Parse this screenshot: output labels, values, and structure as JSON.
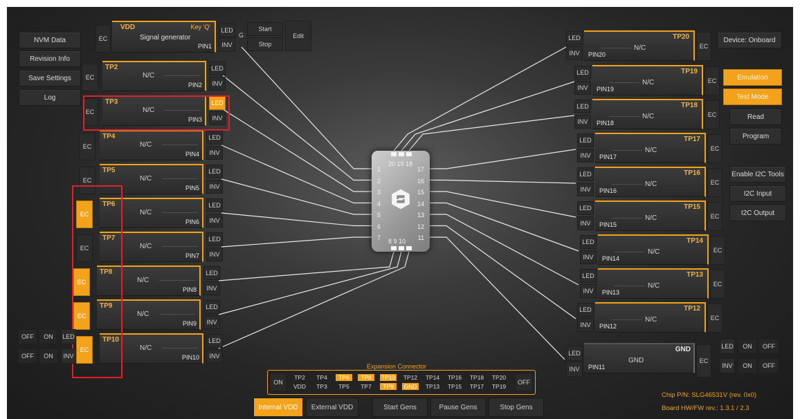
{
  "menu": {
    "left": [
      "NVM Data",
      "Revision Info",
      "Save Settings",
      "Log"
    ],
    "device": "Device: Onboard",
    "mode": [
      "Emulation",
      "Test Mode",
      "Read",
      "Program"
    ],
    "i2c": [
      "Enable I2C Tools",
      "I2C Input",
      "I2C Output"
    ]
  },
  "vdd": {
    "ec": "EC",
    "name": "VDD",
    "key": "Key 'Q'",
    "title": "Signal generator",
    "pin": "PIN1",
    "led": "LED",
    "inv": "INV",
    "g": "G",
    "start": "Start",
    "stop": "Stop",
    "edit": "Edit"
  },
  "common": {
    "nc": "N/C",
    "ec": "EC",
    "led": "LED",
    "inv": "INV"
  },
  "left_tps": [
    {
      "name": "TP2",
      "pin": "PIN2"
    },
    {
      "name": "TP3",
      "pin": "PIN3"
    },
    {
      "name": "TP4",
      "pin": "PIN4"
    },
    {
      "name": "TP5",
      "pin": "PIN5"
    },
    {
      "name": "TP6",
      "pin": "PIN6"
    },
    {
      "name": "TP7",
      "pin": "PIN7"
    },
    {
      "name": "TP8",
      "pin": "PIN8"
    },
    {
      "name": "TP9",
      "pin": "PIN9"
    },
    {
      "name": "TP10",
      "pin": "PIN10"
    }
  ],
  "right_tps": [
    {
      "name": "TP20",
      "pin": "PIN20"
    },
    {
      "name": "TP19",
      "pin": "PIN19"
    },
    {
      "name": "TP18",
      "pin": "PIN18"
    },
    {
      "name": "TP17",
      "pin": "PIN17"
    },
    {
      "name": "TP16",
      "pin": "PIN16"
    },
    {
      "name": "TP15",
      "pin": "PIN15"
    },
    {
      "name": "TP14",
      "pin": "PIN14"
    },
    {
      "name": "TP13",
      "pin": "PIN13"
    },
    {
      "name": "TP12",
      "pin": "PIN12"
    }
  ],
  "gnd": {
    "name": "GND",
    "center": "GND",
    "pin": "PIN11"
  },
  "chip_numbers": {
    "left": [
      "1",
      "2",
      "3",
      "4",
      "5",
      "6",
      "7"
    ],
    "right": [
      "17",
      "16",
      "15",
      "14",
      "13",
      "12",
      "11"
    ],
    "top": "20 19 18",
    "bottom": "8  9 10"
  },
  "offon_left": {
    "off": "OFF",
    "on": "ON",
    "led": "LED",
    "inv": "INV"
  },
  "offon_right": {
    "off": "OFF",
    "on": "ON",
    "led": "LED",
    "inv": "INV"
  },
  "expansion": {
    "title": "Expansion Connector",
    "on": "ON",
    "off": "OFF",
    "row1": [
      "TP2",
      "TP4",
      "TP6",
      "TP8",
      "TP10",
      "TP12",
      "TP14",
      "TP16",
      "TP18",
      "TP20"
    ],
    "row2": [
      "VDD",
      "TP3",
      "TP5",
      "TP7",
      "TP9",
      "GND",
      "TP13",
      "TP15",
      "TP17",
      "TP19"
    ]
  },
  "bottom_buttons": [
    "Internal VDD",
    "External VDD",
    "Start Gens",
    "Pause Gens",
    "Stop Gens"
  ],
  "chip_info": {
    "part": "Chip P/N: SLG46531V (rev. 0x0)",
    "board": "Board HW/FW rev.: 1.3.1 / 2.3"
  },
  "colors": {
    "accent": "#f3a21b",
    "highlight": "#e0202b"
  }
}
